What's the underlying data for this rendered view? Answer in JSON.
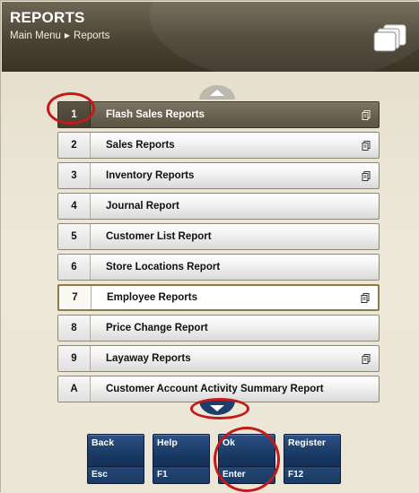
{
  "header": {
    "title": "REPORTS",
    "breadcrumb": [
      "Main Menu",
      "Reports"
    ]
  },
  "menu": {
    "items": [
      {
        "key": "1",
        "label": "Flash Sales Reports",
        "has_submenu": true,
        "state": "selected"
      },
      {
        "key": "2",
        "label": "Sales Reports",
        "has_submenu": true,
        "state": "normal"
      },
      {
        "key": "3",
        "label": "Inventory Reports",
        "has_submenu": true,
        "state": "normal"
      },
      {
        "key": "4",
        "label": "Journal Report",
        "has_submenu": false,
        "state": "normal"
      },
      {
        "key": "5",
        "label": "Customer List Report",
        "has_submenu": false,
        "state": "normal"
      },
      {
        "key": "6",
        "label": "Store Locations Report",
        "has_submenu": false,
        "state": "normal"
      },
      {
        "key": "7",
        "label": "Employee Reports",
        "has_submenu": true,
        "state": "hover"
      },
      {
        "key": "8",
        "label": "Price Change Report",
        "has_submenu": false,
        "state": "normal"
      },
      {
        "key": "9",
        "label": "Layaway Reports",
        "has_submenu": true,
        "state": "normal"
      },
      {
        "key": "A",
        "label": "Customer Account Activity Summary Report",
        "has_submenu": false,
        "state": "normal"
      }
    ]
  },
  "buttons": [
    {
      "label": "Back",
      "key": "Esc"
    },
    {
      "label": "Help",
      "key": "F1"
    },
    {
      "label": "Ok",
      "key": "Enter"
    },
    {
      "label": "Register",
      "key": "F12"
    }
  ],
  "icons": {
    "window": "windows-stack-icon",
    "submenu": "submenu-pages-icon",
    "scroll_up": "chevron-up-icon",
    "scroll_down": "chevron-down-icon"
  },
  "colors": {
    "header": "#4a4233",
    "selected_row": "#5a5242",
    "button": "#17365f",
    "callout": "#c21a1a"
  }
}
